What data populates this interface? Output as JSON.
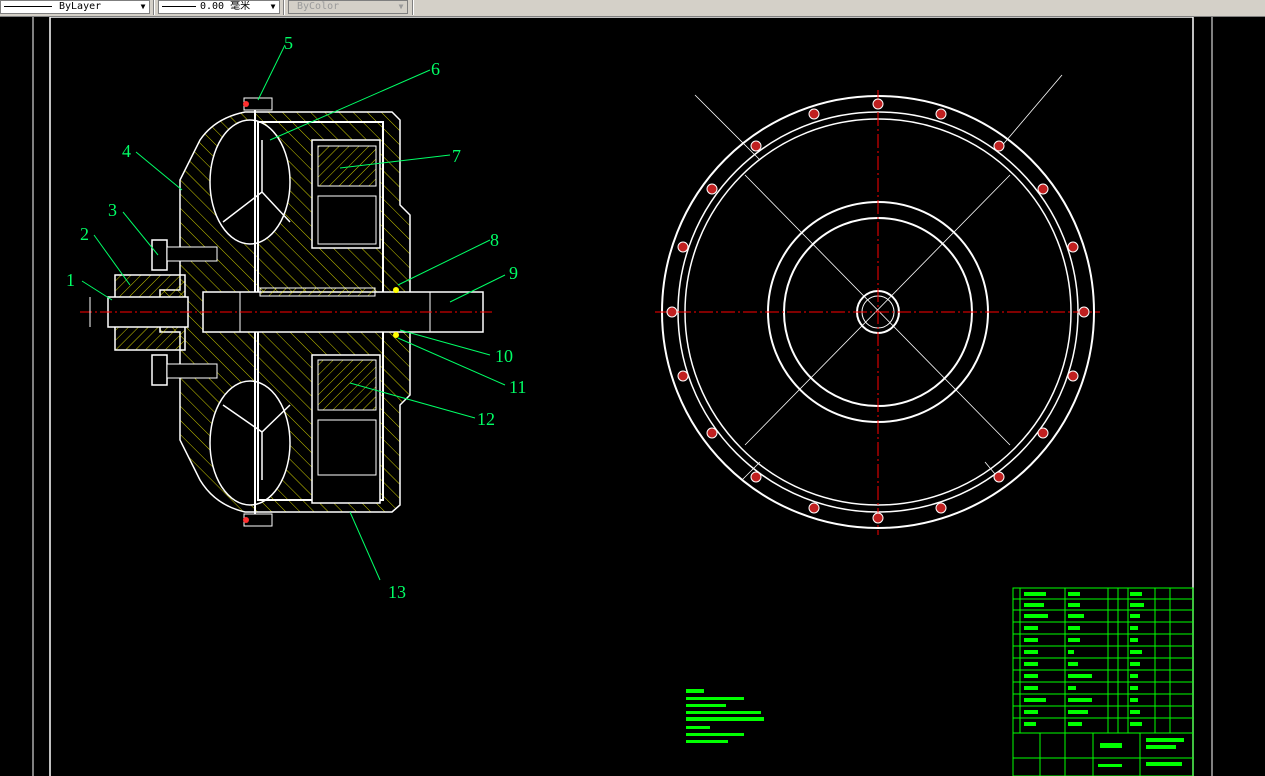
{
  "toolbar": {
    "linetype_value": "ByLayer",
    "lineweight_value": "0.00 毫米",
    "plotstyle_value": "ByColor"
  },
  "drawing": {
    "callouts": [
      "1",
      "2",
      "3",
      "4",
      "5",
      "6",
      "7",
      "8",
      "9",
      "10",
      "11",
      "12",
      "13"
    ],
    "colors": {
      "background": "#000000",
      "outline": "#ffffff",
      "leaders": "#00ff66",
      "centerlines": "#ff0000",
      "hatch": "#ffff00",
      "parts_table": "#00ff00"
    }
  },
  "icons": {
    "dropdown": "chevron-down-icon"
  }
}
